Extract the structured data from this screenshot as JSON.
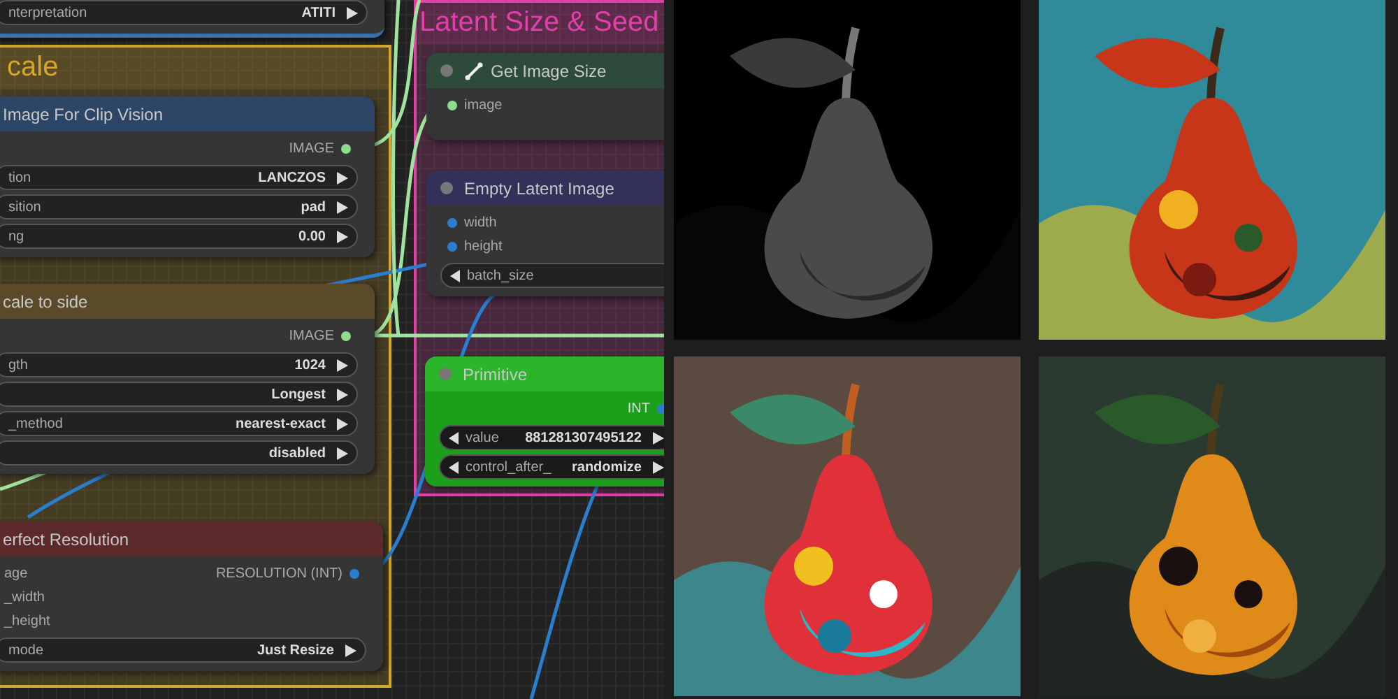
{
  "nodes": [
    {
      "widgets": [
        {
          "label": "nterpretation",
          "value": "ATITI"
        }
      ]
    }
  ],
  "groups": [
    {
      "title": "cale",
      "color": "#d4a72c",
      "nodes": [
        {
          "title": "Image For Clip Vision",
          "color": "#2d4566",
          "outputs": [
            {
              "label": "IMAGE",
              "color": "#8fdc8f"
            }
          ],
          "widgets": [
            {
              "label": "tion",
              "value": "LANCZOS"
            },
            {
              "label": "sition",
              "value": "pad"
            },
            {
              "label": "ng",
              "value": "0.00"
            }
          ]
        },
        {
          "title": "cale to side",
          "color": "#5a4a2a",
          "outputs": [
            {
              "label": "IMAGE",
              "color": "#8fdc8f"
            }
          ],
          "widgets": [
            {
              "label": "gth",
              "value": "1024"
            },
            {
              "value": "Longest"
            },
            {
              "label": "_method",
              "value": "nearest-exact"
            },
            {
              "value": "disabled"
            }
          ]
        },
        {
          "title": "erfect Resolution",
          "color": "#5c2a2a",
          "inputs": [
            {
              "label": "age"
            },
            {
              "label": "_width"
            },
            {
              "label": "_height"
            }
          ],
          "outputs": [
            {
              "label": "RESOLUTION (INT)",
              "color": "#2a7ed0"
            }
          ],
          "widgets": [
            {
              "label": "mode",
              "value": "Just Resize"
            }
          ]
        }
      ]
    },
    {
      "title": "Latent Size & Seed",
      "color": "#e040a8",
      "nodes": [
        {
          "title": "Get Image Size",
          "color": "#2e4a3a",
          "icon": true,
          "inputs": [
            {
              "label": "image",
              "color": "#8fdc8f"
            }
          ]
        },
        {
          "title": "Empty Latent Image",
          "color": "#33305a",
          "inputs": [
            {
              "label": "width",
              "color": "#2a7ed0"
            },
            {
              "label": "height",
              "color": "#2a7ed0"
            }
          ],
          "widgets": [
            {
              "label": "batch_size"
            }
          ]
        },
        {
          "title": "Primitive",
          "color": "#2ab52a",
          "outputs": [
            {
              "label": "INT",
              "color": "#2a7ed0"
            }
          ],
          "widgets": [
            {
              "label": "value",
              "value": "881281307495122"
            },
            {
              "label": "control_after_",
              "value": "randomize"
            }
          ]
        }
      ]
    }
  ]
}
